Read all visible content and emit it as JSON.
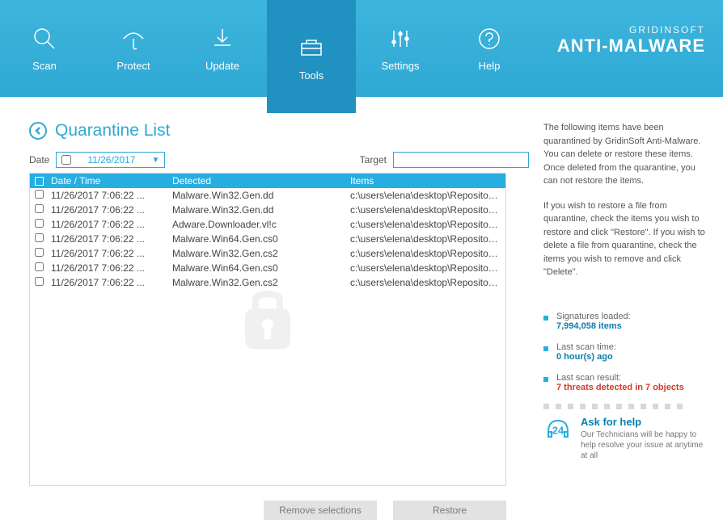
{
  "brand": {
    "line1": "GRIDINSOFT",
    "line2": "ANTI-MALWARE"
  },
  "nav": {
    "items": [
      {
        "label": "Scan"
      },
      {
        "label": "Protect"
      },
      {
        "label": "Update"
      },
      {
        "label": "Tools"
      },
      {
        "label": "Settings"
      },
      {
        "label": "Help"
      }
    ]
  },
  "page": {
    "title": "Quarantine List"
  },
  "filters": {
    "date_label": "Date",
    "date_value": "11/26/2017",
    "target_label": "Target",
    "target_value": ""
  },
  "table": {
    "headers": {
      "date": "Date / Time",
      "detected": "Detected",
      "items": "Items"
    },
    "rows": [
      {
        "dt": "11/26/2017 7:06:22 ...",
        "det": "Malware.Win32.Gen.dd",
        "it": "c:\\users\\elena\\desktop\\Repository_..."
      },
      {
        "dt": "11/26/2017 7:06:22 ...",
        "det": "Malware.Win32.Gen.dd",
        "it": "c:\\users\\elena\\desktop\\Repository_..."
      },
      {
        "dt": "11/26/2017 7:06:22 ...",
        "det": "Adware.Downloader.vl!c",
        "it": "c:\\users\\elena\\desktop\\Repository_..."
      },
      {
        "dt": "11/26/2017 7:06:22 ...",
        "det": "Malware.Win64.Gen.cs0",
        "it": "c:\\users\\elena\\desktop\\Repository_..."
      },
      {
        "dt": "11/26/2017 7:06:22 ...",
        "det": "Malware.Win32.Gen.cs2",
        "it": "c:\\users\\elena\\desktop\\Repository_..."
      },
      {
        "dt": "11/26/2017 7:06:22 ...",
        "det": "Malware.Win64.Gen.cs0",
        "it": "c:\\users\\elena\\desktop\\Repository_..."
      },
      {
        "dt": "11/26/2017 7:06:22 ...",
        "det": "Malware.Win32.Gen.cs2",
        "it": "c:\\users\\elena\\desktop\\Repository_..."
      }
    ]
  },
  "actions": {
    "remove": "Remove selections",
    "restore": "Restore"
  },
  "info": {
    "p1": "The following items have been quarantined by GridinSoft Anti-Malware. You can delete or restore these items. Once deleted from the quarantine, you can not restore the items.",
    "p2": "If you wish to restore a file from quarantine, check the items you wish to restore and click \"Restore\". If you wish to delete a file from quarantine, check the items you wish to remove and click \"Delete\"."
  },
  "stats": {
    "sig_label": "Signatures loaded:",
    "sig_value": "7,994,058 items",
    "last_scan_label": "Last scan time:",
    "last_scan_value": "0 hour(s) ago",
    "result_label": "Last scan result:",
    "result_value": "7 threats detected in 7 objects"
  },
  "help": {
    "number": "24",
    "title": "Ask for help",
    "sub": "Our Technicians will be happy to help resolve your issue at anytime at all"
  }
}
